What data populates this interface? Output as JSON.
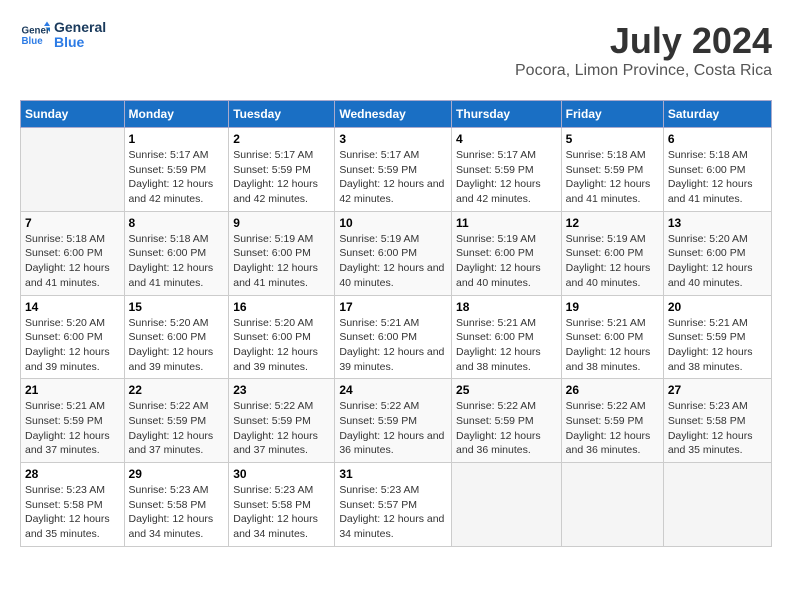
{
  "logo": {
    "line1": "General",
    "line2": "Blue"
  },
  "title": "July 2024",
  "location": "Pocora, Limon Province, Costa Rica",
  "days_header": [
    "Sunday",
    "Monday",
    "Tuesday",
    "Wednesday",
    "Thursday",
    "Friday",
    "Saturday"
  ],
  "weeks": [
    [
      {
        "day": "",
        "sunrise": "",
        "sunset": "",
        "daylight": ""
      },
      {
        "day": "1",
        "sunrise": "Sunrise: 5:17 AM",
        "sunset": "Sunset: 5:59 PM",
        "daylight": "Daylight: 12 hours and 42 minutes."
      },
      {
        "day": "2",
        "sunrise": "Sunrise: 5:17 AM",
        "sunset": "Sunset: 5:59 PM",
        "daylight": "Daylight: 12 hours and 42 minutes."
      },
      {
        "day": "3",
        "sunrise": "Sunrise: 5:17 AM",
        "sunset": "Sunset: 5:59 PM",
        "daylight": "Daylight: 12 hours and 42 minutes."
      },
      {
        "day": "4",
        "sunrise": "Sunrise: 5:17 AM",
        "sunset": "Sunset: 5:59 PM",
        "daylight": "Daylight: 12 hours and 42 minutes."
      },
      {
        "day": "5",
        "sunrise": "Sunrise: 5:18 AM",
        "sunset": "Sunset: 5:59 PM",
        "daylight": "Daylight: 12 hours and 41 minutes."
      },
      {
        "day": "6",
        "sunrise": "Sunrise: 5:18 AM",
        "sunset": "Sunset: 6:00 PM",
        "daylight": "Daylight: 12 hours and 41 minutes."
      }
    ],
    [
      {
        "day": "7",
        "sunrise": "Sunrise: 5:18 AM",
        "sunset": "Sunset: 6:00 PM",
        "daylight": "Daylight: 12 hours and 41 minutes."
      },
      {
        "day": "8",
        "sunrise": "Sunrise: 5:18 AM",
        "sunset": "Sunset: 6:00 PM",
        "daylight": "Daylight: 12 hours and 41 minutes."
      },
      {
        "day": "9",
        "sunrise": "Sunrise: 5:19 AM",
        "sunset": "Sunset: 6:00 PM",
        "daylight": "Daylight: 12 hours and 41 minutes."
      },
      {
        "day": "10",
        "sunrise": "Sunrise: 5:19 AM",
        "sunset": "Sunset: 6:00 PM",
        "daylight": "Daylight: 12 hours and 40 minutes."
      },
      {
        "day": "11",
        "sunrise": "Sunrise: 5:19 AM",
        "sunset": "Sunset: 6:00 PM",
        "daylight": "Daylight: 12 hours and 40 minutes."
      },
      {
        "day": "12",
        "sunrise": "Sunrise: 5:19 AM",
        "sunset": "Sunset: 6:00 PM",
        "daylight": "Daylight: 12 hours and 40 minutes."
      },
      {
        "day": "13",
        "sunrise": "Sunrise: 5:20 AM",
        "sunset": "Sunset: 6:00 PM",
        "daylight": "Daylight: 12 hours and 40 minutes."
      }
    ],
    [
      {
        "day": "14",
        "sunrise": "Sunrise: 5:20 AM",
        "sunset": "Sunset: 6:00 PM",
        "daylight": "Daylight: 12 hours and 39 minutes."
      },
      {
        "day": "15",
        "sunrise": "Sunrise: 5:20 AM",
        "sunset": "Sunset: 6:00 PM",
        "daylight": "Daylight: 12 hours and 39 minutes."
      },
      {
        "day": "16",
        "sunrise": "Sunrise: 5:20 AM",
        "sunset": "Sunset: 6:00 PM",
        "daylight": "Daylight: 12 hours and 39 minutes."
      },
      {
        "day": "17",
        "sunrise": "Sunrise: 5:21 AM",
        "sunset": "Sunset: 6:00 PM",
        "daylight": "Daylight: 12 hours and 39 minutes."
      },
      {
        "day": "18",
        "sunrise": "Sunrise: 5:21 AM",
        "sunset": "Sunset: 6:00 PM",
        "daylight": "Daylight: 12 hours and 38 minutes."
      },
      {
        "day": "19",
        "sunrise": "Sunrise: 5:21 AM",
        "sunset": "Sunset: 6:00 PM",
        "daylight": "Daylight: 12 hours and 38 minutes."
      },
      {
        "day": "20",
        "sunrise": "Sunrise: 5:21 AM",
        "sunset": "Sunset: 5:59 PM",
        "daylight": "Daylight: 12 hours and 38 minutes."
      }
    ],
    [
      {
        "day": "21",
        "sunrise": "Sunrise: 5:21 AM",
        "sunset": "Sunset: 5:59 PM",
        "daylight": "Daylight: 12 hours and 37 minutes."
      },
      {
        "day": "22",
        "sunrise": "Sunrise: 5:22 AM",
        "sunset": "Sunset: 5:59 PM",
        "daylight": "Daylight: 12 hours and 37 minutes."
      },
      {
        "day": "23",
        "sunrise": "Sunrise: 5:22 AM",
        "sunset": "Sunset: 5:59 PM",
        "daylight": "Daylight: 12 hours and 37 minutes."
      },
      {
        "day": "24",
        "sunrise": "Sunrise: 5:22 AM",
        "sunset": "Sunset: 5:59 PM",
        "daylight": "Daylight: 12 hours and 36 minutes."
      },
      {
        "day": "25",
        "sunrise": "Sunrise: 5:22 AM",
        "sunset": "Sunset: 5:59 PM",
        "daylight": "Daylight: 12 hours and 36 minutes."
      },
      {
        "day": "26",
        "sunrise": "Sunrise: 5:22 AM",
        "sunset": "Sunset: 5:59 PM",
        "daylight": "Daylight: 12 hours and 36 minutes."
      },
      {
        "day": "27",
        "sunrise": "Sunrise: 5:23 AM",
        "sunset": "Sunset: 5:58 PM",
        "daylight": "Daylight: 12 hours and 35 minutes."
      }
    ],
    [
      {
        "day": "28",
        "sunrise": "Sunrise: 5:23 AM",
        "sunset": "Sunset: 5:58 PM",
        "daylight": "Daylight: 12 hours and 35 minutes."
      },
      {
        "day": "29",
        "sunrise": "Sunrise: 5:23 AM",
        "sunset": "Sunset: 5:58 PM",
        "daylight": "Daylight: 12 hours and 34 minutes."
      },
      {
        "day": "30",
        "sunrise": "Sunrise: 5:23 AM",
        "sunset": "Sunset: 5:58 PM",
        "daylight": "Daylight: 12 hours and 34 minutes."
      },
      {
        "day": "31",
        "sunrise": "Sunrise: 5:23 AM",
        "sunset": "Sunset: 5:57 PM",
        "daylight": "Daylight: 12 hours and 34 minutes."
      },
      {
        "day": "",
        "sunrise": "",
        "sunset": "",
        "daylight": ""
      },
      {
        "day": "",
        "sunrise": "",
        "sunset": "",
        "daylight": ""
      },
      {
        "day": "",
        "sunrise": "",
        "sunset": "",
        "daylight": ""
      }
    ]
  ]
}
